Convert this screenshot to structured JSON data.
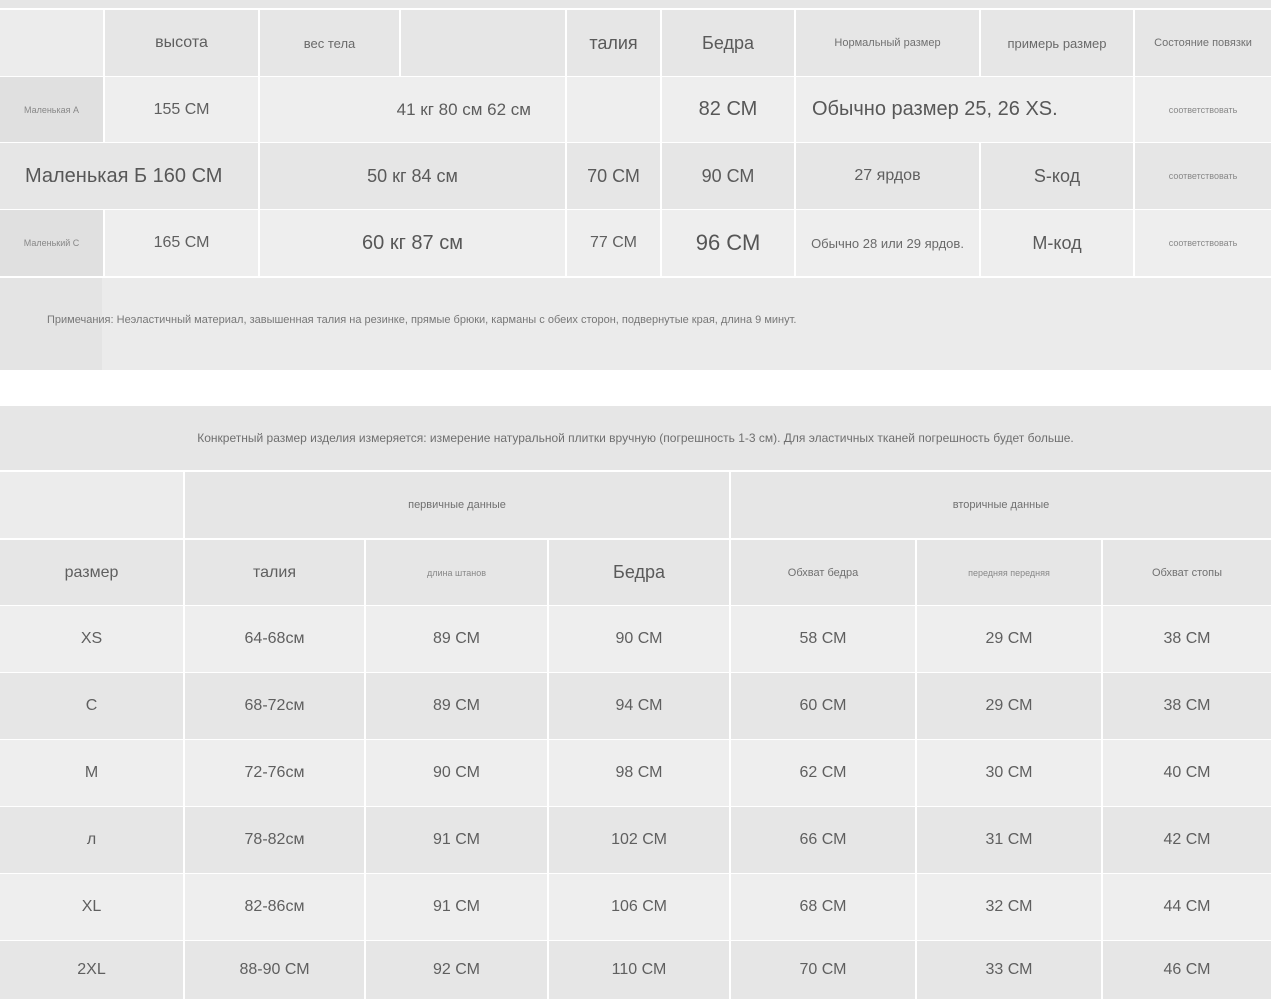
{
  "top_table": {
    "headers": {
      "height": "высота",
      "weight": "вес тела",
      "col3": "",
      "waist": "талия",
      "hips": "Бедра",
      "normal_size": "Нормальный размер",
      "try_size": "примерь размер",
      "fit": "Состояние повязки"
    },
    "row_a": {
      "label": "Маленькая А",
      "height": "155 СМ",
      "weight_waist_hips": "41 кг 80 см 62 см",
      "hips": "82 СМ",
      "size": "Обычно размер 25, 26 XS.",
      "fit": "соответствовать"
    },
    "row_b": {
      "label": "Маленькая Б 160 СМ",
      "weight": "50 кг 84 см",
      "waist": "70 СМ",
      "hips": "90 СМ",
      "normal_size": "27 ярдов",
      "try_size": "S-код",
      "fit": "соответствовать"
    },
    "row_c": {
      "label": "Маленький С",
      "height": "165 СМ",
      "weight": "60 кг 87 см",
      "waist": "77 СМ",
      "hips": "96 СМ",
      "normal_size": "Обычно 28 или 29 ярдов.",
      "try_size": "М-код",
      "fit": "соответствовать"
    },
    "notes": "Примечания: Неэластичный материал, завышенная талия на резинке, прямые брюки, карманы с обеих сторон, подвернутые края, длина 9 минут."
  },
  "banner": "Конкретный размер изделия измеряется: измерение натуральной плитки вручную (погрешность 1-3 см). Для эластичных тканей погрешность будет больше.",
  "size_table": {
    "group_primary": "первичные данные",
    "group_secondary": "вторичные данные",
    "columns": [
      "размер",
      "талия",
      "длина штанов",
      "Бедра",
      "Обхват бедра",
      "передняя передняя",
      "Обхват стопы"
    ],
    "rows": [
      [
        "XS",
        "64-68см",
        "89 СМ",
        "90 СМ",
        "58 СМ",
        "29 СМ",
        "38 СМ"
      ],
      [
        "С",
        "68-72см",
        "89 СМ",
        "94 СМ",
        "60 СМ",
        "29 СМ",
        "38 СМ"
      ],
      [
        "М",
        "72-76см",
        "90 СМ",
        "98 СМ",
        "62 СМ",
        "30 СМ",
        "40 СМ"
      ],
      [
        "л",
        "78-82см",
        "91 СМ",
        "102 СМ",
        "66 СМ",
        "31 СМ",
        "42 СМ"
      ],
      [
        "XL",
        "82-86см",
        "91 СМ",
        "106 СМ",
        "68 СМ",
        "32 СМ",
        "44 СМ"
      ],
      [
        "2XL",
        "88-90 СМ",
        "92 СМ",
        "110 СМ",
        "70 СМ",
        "33 СМ",
        "46 СМ"
      ]
    ]
  }
}
